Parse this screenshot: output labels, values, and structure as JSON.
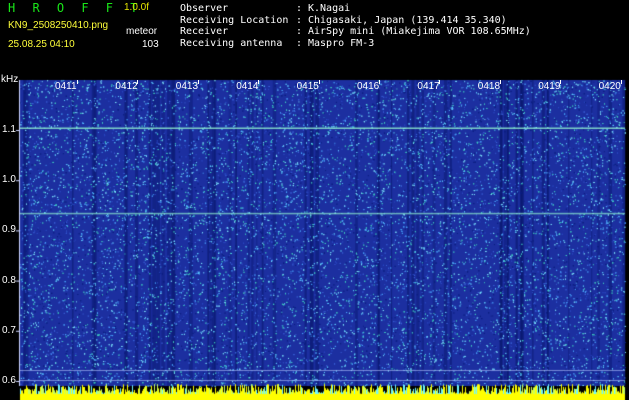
{
  "header": {
    "app_title": "H R O F F T",
    "version": "1.0.0f",
    "file_name": "KN9_2508250410.png",
    "datetime": "25.08.25 04:10",
    "meteor_label": "meteor",
    "meteor_count": "103"
  },
  "info": [
    {
      "key": "Observer",
      "sep": ":",
      "value": "K.Nagai"
    },
    {
      "key": "Receiving Location",
      "sep": ":",
      "value": "Chigasaki, Japan (139.414 35.340)"
    },
    {
      "key": "Receiver",
      "sep": ":",
      "value": "AirSpy mini (Miakejima VOR 108.65MHz)"
    },
    {
      "key": "Receiving antenna",
      "sep": ":",
      "value": "Maspro FM-3"
    }
  ],
  "chart_data": {
    "type": "heatmap",
    "ylabel": "kHz",
    "y_ticks": [
      "1.1",
      "1.0",
      "0.9",
      "0.8",
      "0.7",
      "0.6"
    ],
    "y_tick_values": [
      1.1,
      1.0,
      0.9,
      0.8,
      0.7,
      0.6
    ],
    "x_ticks": [
      "0411",
      "0412",
      "0413",
      "0414",
      "0415",
      "0416",
      "0417",
      "0418",
      "0419",
      "0420"
    ],
    "ylim": [
      0.57,
      1.2
    ],
    "horizontal_lines_khz": [
      1.105,
      0.935
    ],
    "colors": {
      "background": "#1c2fa0",
      "dark": "#061466",
      "noise": "#5fd0ff",
      "line": "#8ff0d0",
      "bottom_bar": "#ffff00"
    }
  }
}
